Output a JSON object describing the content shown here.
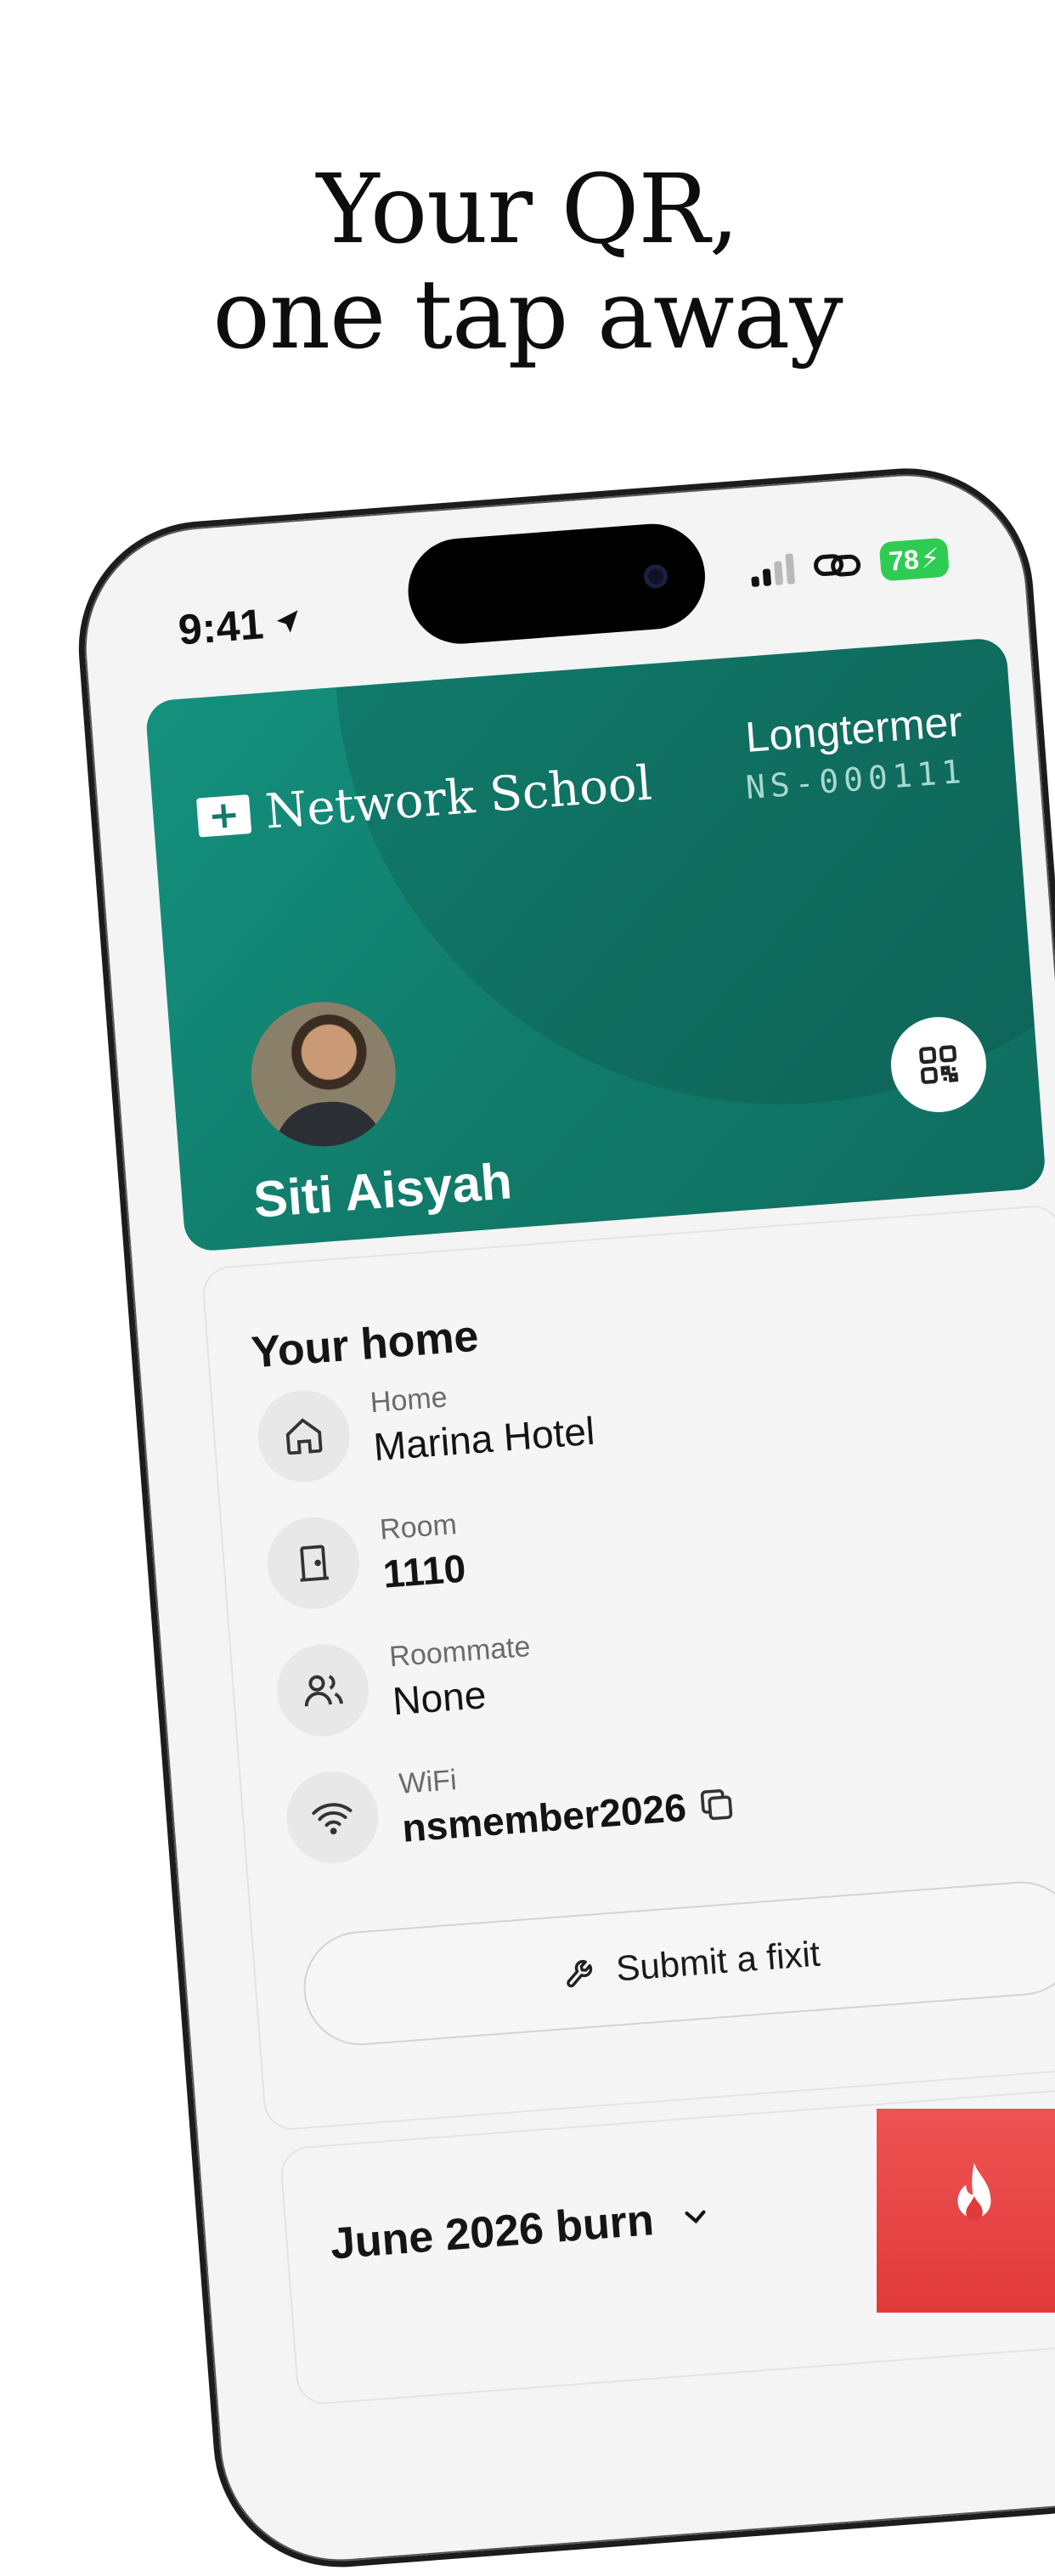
{
  "headline": {
    "line1": "Your QR,",
    "line2": "one tap away"
  },
  "status_bar": {
    "time": "9:41",
    "battery": "78"
  },
  "card": {
    "brand": "Network School",
    "tier": "Longtermer",
    "member_id": "NS-000111",
    "name": "Siti Aisyah"
  },
  "home": {
    "title": "Your home",
    "rows": [
      {
        "label": "Home",
        "value": "Marina Hotel"
      },
      {
        "label": "Room",
        "value": "1110"
      },
      {
        "label": "Roommate",
        "value": "None"
      },
      {
        "label": "WiFi",
        "value": "nsmember2026"
      }
    ],
    "fixit_label": "Submit a fixit"
  },
  "burn": {
    "title": "June 2026 burn"
  },
  "colors": {
    "card_green": "#117a69",
    "battery_green": "#2ecc52",
    "fire_red": "#e23a3a"
  }
}
